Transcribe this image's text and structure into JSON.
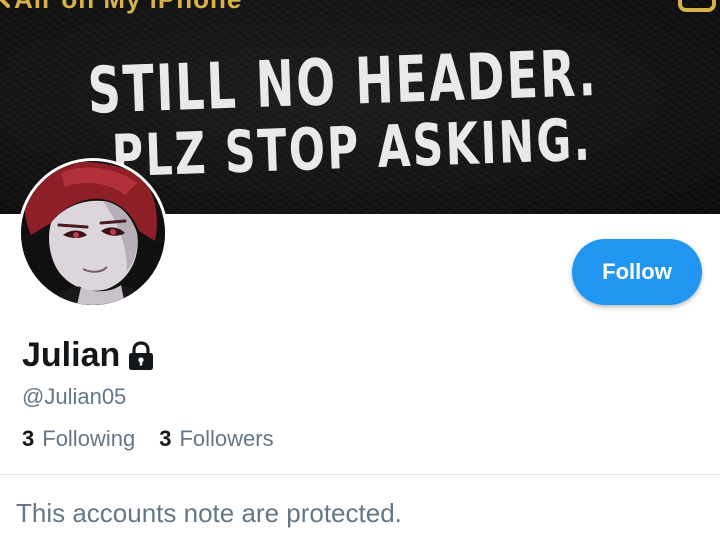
{
  "status_bar": {
    "text": "Air on My iPhone"
  },
  "banner": {
    "line1": "STILL NO HEADER.",
    "line2": "PLZ STOP ASKING."
  },
  "profile": {
    "name": "Julian",
    "handle": "@Julian05",
    "following_count": "3",
    "following_label": "Following",
    "followers_count": "3",
    "followers_label": "Followers",
    "follow_button_label": "Follow",
    "protected_note": "This accounts note are protected."
  },
  "colors": {
    "accent": "#2196f0",
    "text_primary": "#14171a",
    "text_secondary": "#657786",
    "banner_bg": "#141414",
    "status_text": "#d9b14a"
  },
  "icons": {
    "lock": "lock-icon",
    "back": "chevron-left-icon"
  }
}
